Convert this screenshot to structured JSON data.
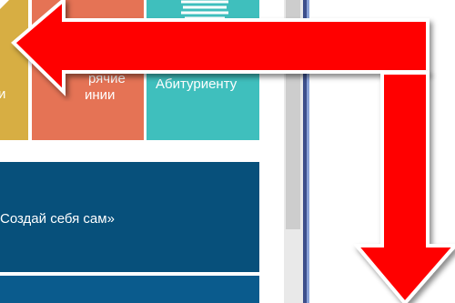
{
  "tiles": {
    "yellow_label": "и",
    "orange_label_line1": "рячие",
    "orange_label_line2": "инии",
    "teal_label": "Абитуриенту",
    "teal_icon": "books-icon"
  },
  "banner": {
    "text": "Создай себя сам»"
  },
  "annotation": {
    "arrow_color": "#ff0000",
    "arrows": [
      "arrow-left",
      "arrow-down"
    ]
  },
  "colors": {
    "yellow_tile": "#d7ae43",
    "orange_tile": "#e57355",
    "teal_tile": "#3fbfbd",
    "banner_blue": "#07507b"
  }
}
